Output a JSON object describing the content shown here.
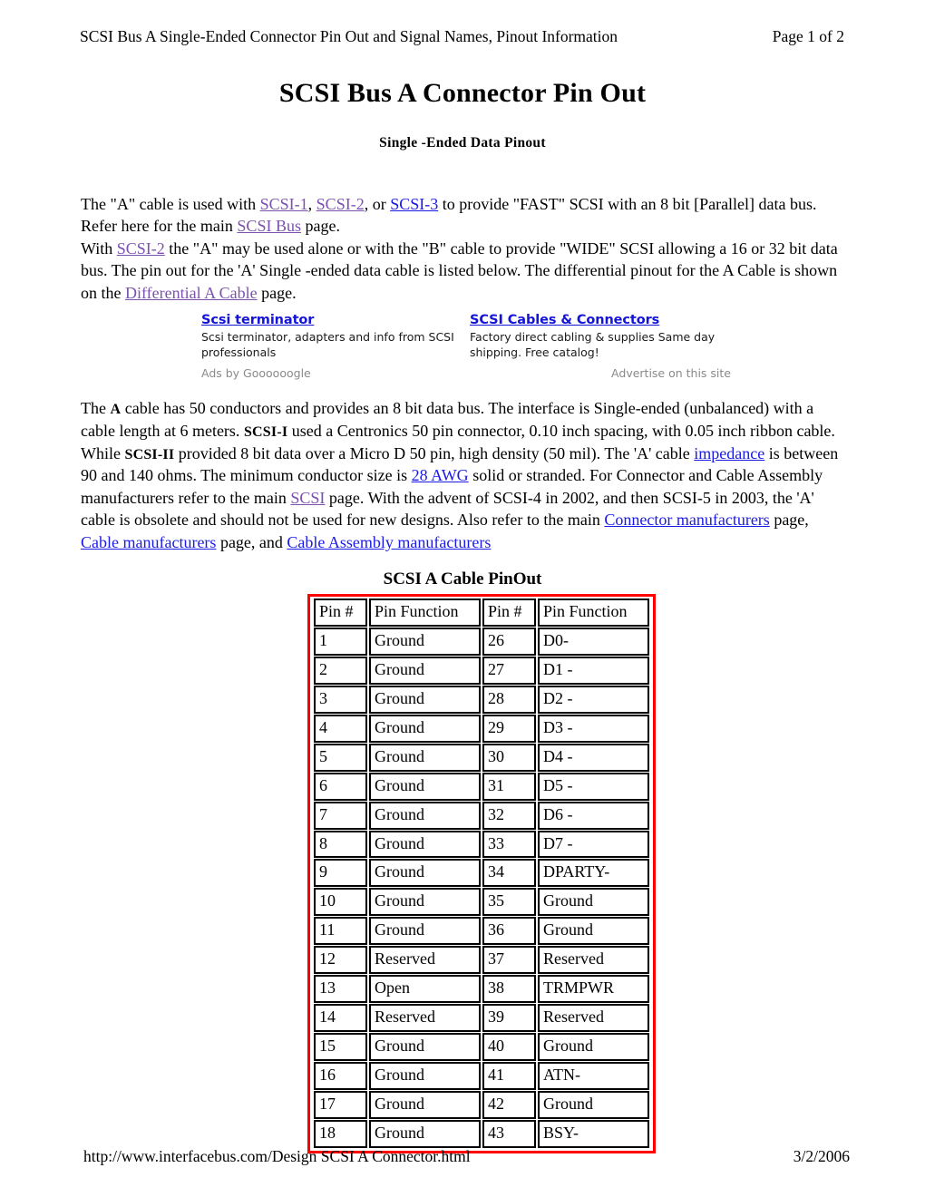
{
  "header": {
    "left": "SCSI Bus A Single-Ended Connector Pin Out and Signal Names, Pinout Information",
    "right": "Page 1 of 2"
  },
  "title": "SCSI Bus A Connector Pin Out",
  "subtitle": "Single -Ended Data Pinout",
  "intro": {
    "s1": "The \"A\" cable is used with ",
    "l_scsi1": "SCSI-1",
    "s2": ", ",
    "l_scsi2": "SCSI-2",
    "s3": ", or ",
    "l_scsi3": "SCSI-3",
    "s4": " to provide \"FAST\" SCSI with an 8 bit [Parallel] data bus. Refer here for the main ",
    "l_scsibus": "SCSI Bus",
    "s5": " page.",
    "s6": "With ",
    "l_scsi2b": "SCSI-2",
    "s7": " the \"A\" may be used alone or with the \"B\" cable to provide \"WIDE\" SCSI allowing a 16 or 32 bit data bus. The pin out for the 'A' Single -ended data cable is listed below. The differential pinout for the A Cable is shown on the ",
    "l_diffa": "Differential A Cable",
    "s8": " page."
  },
  "ads": {
    "col1": {
      "title": "Scsi terminator",
      "desc": "Scsi terminator, adapters and info from SCSI professionals"
    },
    "col2": {
      "title": "SCSI Cables & Connectors",
      "desc": "Factory direct cabling & supplies Same day shipping. Free catalog!"
    },
    "by": "Ads by Goooooogle",
    "advertise": "Advertise on this site"
  },
  "detail": {
    "s1": "The ",
    "b_a": "A",
    "s2": " cable has 50 conductors and provides an 8 bit data bus. The interface is Single-ended (unbalanced) with a cable length at 6 meters. ",
    "b_scsi1": "SCSI-I",
    "s3": " used a Centronics 50 pin connector, 0.10 inch spacing, with 0.05 inch ribbon cable. While ",
    "b_scsi2": "SCSI-II",
    "s4": " provided 8 bit data over a Micro D 50 pin, high density (50 mil). The 'A' cable ",
    "l_impedance": "impedance",
    "s5": " is between 90 and 140 ohms. The minimum conductor size is ",
    "l_awg": "28 AWG",
    "s6": " solid or stranded. For Connector and Cable Assembly manufacturers refer to the main ",
    "l_scsi": "SCSI",
    "s7": " page. With the advent of SCSI-4 in 2002, and then SCSI-5 in 2003, the 'A' cable is obsolete and should not be used for new designs. Also refer to the main ",
    "l_connmfg": "Connector manufacturers",
    "s8": " page, ",
    "l_cablemfg": "Cable manufacturers",
    "s9": " page, and ",
    "l_asmmfg": "Cable Assembly manufacturers"
  },
  "table": {
    "caption": "SCSI A Cable PinOut",
    "border_color": "#ff0000",
    "columns": [
      "Pin #",
      "Pin Function",
      "Pin #",
      "Pin Function"
    ],
    "rows": [
      [
        "1",
        "Ground",
        "26",
        "D0-"
      ],
      [
        "2",
        "Ground",
        "27",
        "D1 -"
      ],
      [
        "3",
        "Ground",
        "28",
        "D2 -"
      ],
      [
        "4",
        "Ground",
        "29",
        "D3 -"
      ],
      [
        "5",
        "Ground",
        "30",
        "D4 -"
      ],
      [
        "6",
        "Ground",
        "31",
        "D5 -"
      ],
      [
        "7",
        "Ground",
        "32",
        "D6 -"
      ],
      [
        "8",
        "Ground",
        "33",
        "D7 -"
      ],
      [
        "9",
        "Ground",
        "34",
        "DPARTY-"
      ],
      [
        "10",
        "Ground",
        "35",
        "Ground"
      ],
      [
        "11",
        "Ground",
        "36",
        "Ground"
      ],
      [
        "12",
        "Reserved",
        "37",
        "Reserved"
      ],
      [
        "13",
        "Open",
        "38",
        "TRMPWR"
      ],
      [
        "14",
        "Reserved",
        "39",
        "Reserved"
      ],
      [
        "15",
        "Ground",
        "40",
        "Ground"
      ],
      [
        "16",
        "Ground",
        "41",
        "ATN-"
      ],
      [
        "17",
        "Ground",
        "42",
        "Ground"
      ],
      [
        "18",
        "Ground",
        "43",
        "BSY-"
      ]
    ]
  },
  "footer": {
    "url": "http://www.interfacebus.com/Design  SCSI  A  Connector.html",
    "date": "3/2/2006"
  }
}
